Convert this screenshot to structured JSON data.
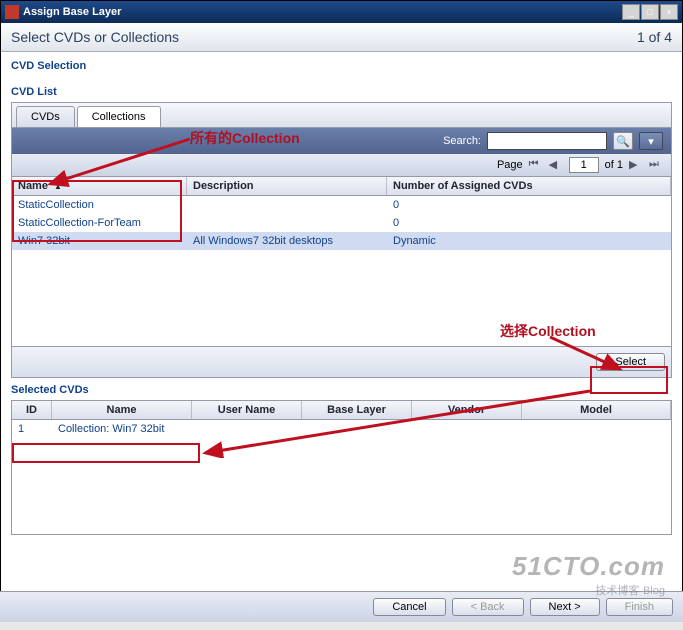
{
  "window": {
    "title": "Assign Base Layer"
  },
  "header": {
    "title": "Select CVDs or Collections",
    "step": "1 of 4"
  },
  "section": {
    "cvd_selection": "CVD Selection",
    "cvd_list": "CVD List",
    "selected_cvds": "Selected CVDs"
  },
  "tabs": {
    "cvds": "CVDs",
    "collections": "Collections"
  },
  "toolbar": {
    "search_label": "Search:",
    "search_value": ""
  },
  "pager": {
    "label_page": "Page",
    "value": "1",
    "label_of": "of 1"
  },
  "grid": {
    "headers": {
      "name": "Name",
      "desc": "Description",
      "num": "Number of Assigned CVDs"
    },
    "rows": [
      {
        "name": "StaticCollection",
        "desc": "",
        "num": "0"
      },
      {
        "name": "StaticCollection-ForTeam",
        "desc": "",
        "num": "0"
      },
      {
        "name": "Win7 32bit",
        "desc": "All Windows7 32bit desktops",
        "num": "Dynamic"
      }
    ]
  },
  "buttons": {
    "select": "Select",
    "cancel": "Cancel",
    "back": "< Back",
    "next": "Next >",
    "finish": "Finish"
  },
  "selected_grid": {
    "headers": {
      "id": "ID",
      "name": "Name",
      "user": "User Name",
      "base": "Base Layer",
      "vendor": "Vendor",
      "model": "Model"
    },
    "rows": [
      {
        "id": "1",
        "name": "Collection: Win7 32bit"
      }
    ]
  },
  "annotations": {
    "all_collection": "所有的Collection",
    "choose_collection": "选择Collection"
  },
  "watermark": {
    "line1": "51CTO.com",
    "line2": "技术博客",
    "line3": "Blog"
  }
}
